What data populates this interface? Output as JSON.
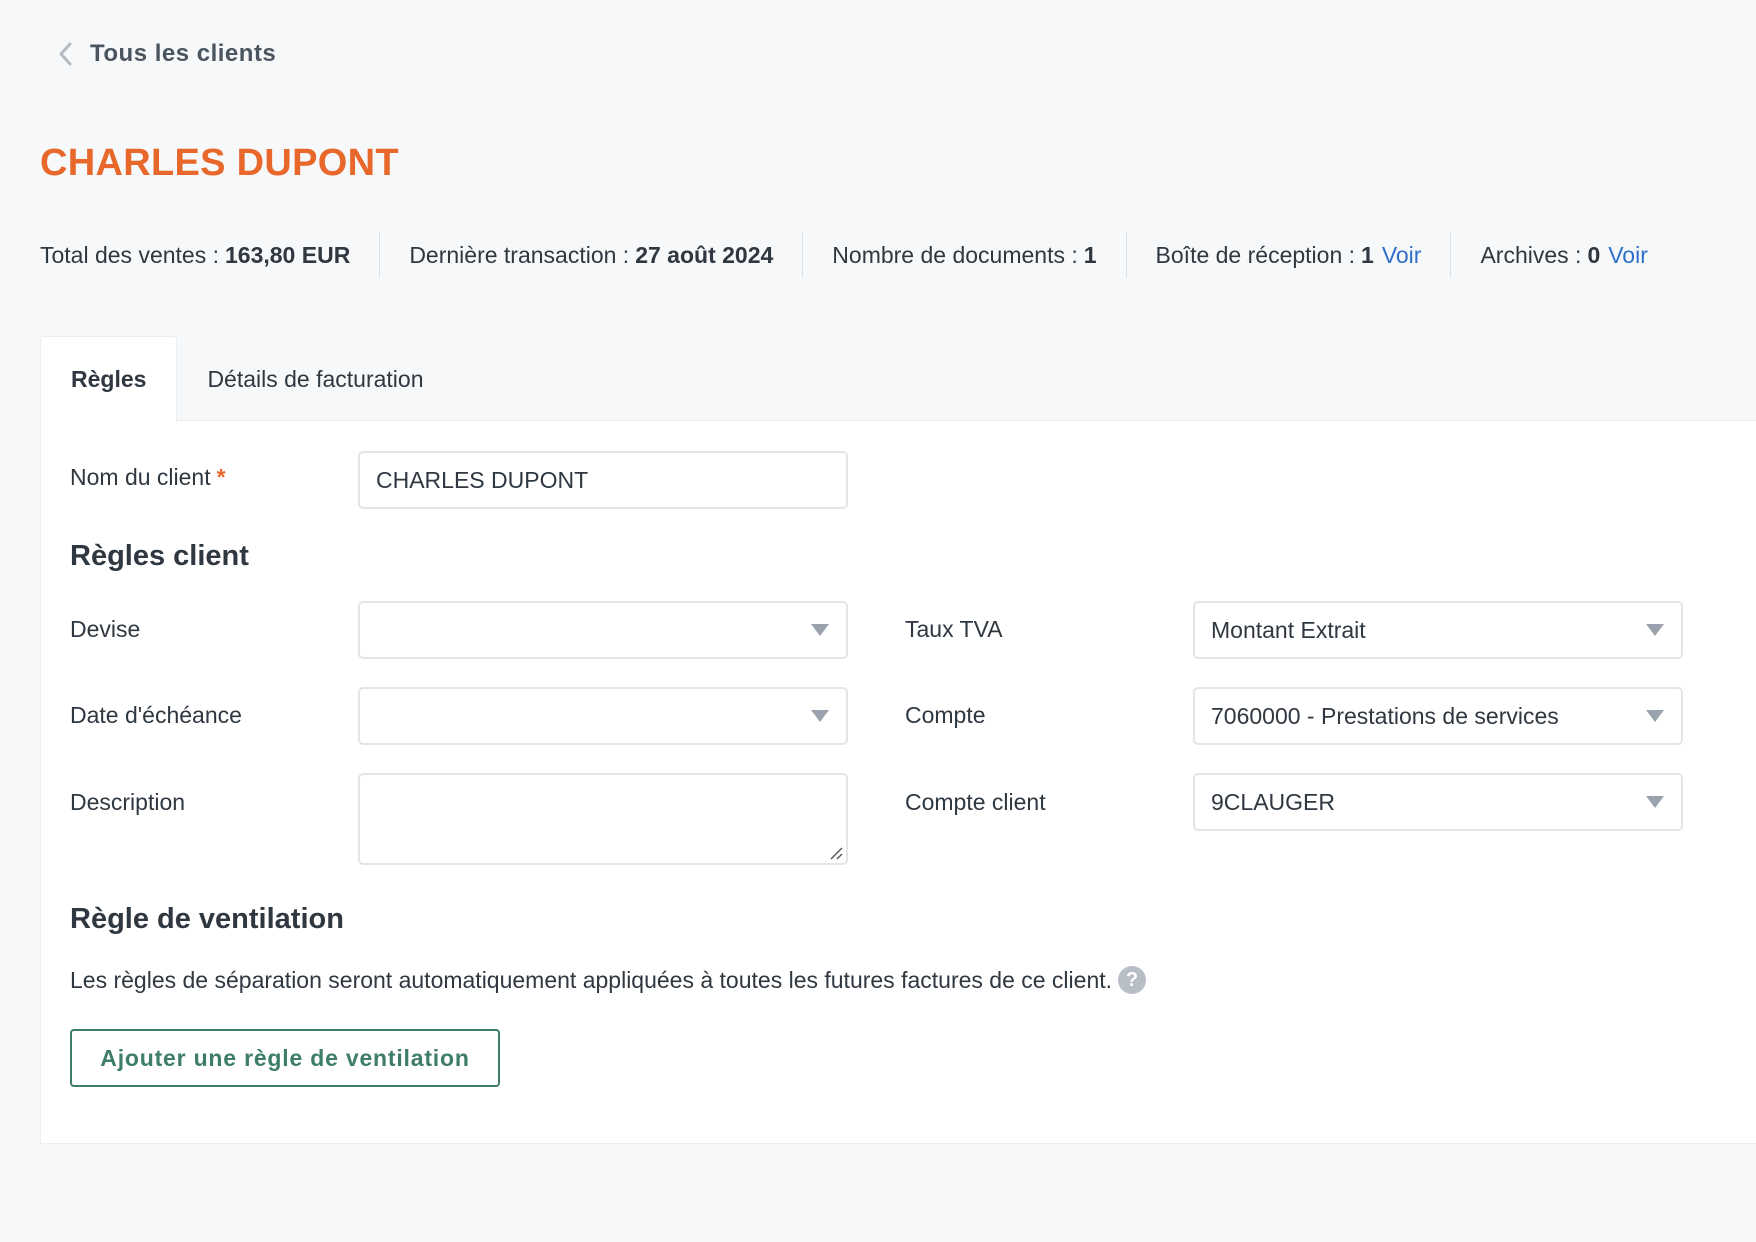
{
  "nav": {
    "back_label": "Tous les clients"
  },
  "client": {
    "title": "CHARLES DUPONT"
  },
  "stats": [
    {
      "label": "Total des ventes :",
      "value": "163,80 EUR"
    },
    {
      "label": "Dernière transaction :",
      "value": "27 août 2024"
    },
    {
      "label": "Nombre de documents :",
      "value": "1"
    },
    {
      "label": "Boîte de réception :",
      "value": "1",
      "link": "Voir"
    },
    {
      "label": "Archives :",
      "value": "0",
      "link": "Voir"
    }
  ],
  "tabs": [
    {
      "label": "Règles",
      "active": true
    },
    {
      "label": "Détails de facturation",
      "active": false
    }
  ],
  "form": {
    "client_name_label": "Nom du client",
    "required_mark": "*",
    "client_name_value": "CHARLES DUPONT",
    "rules_section_title": "Règles client",
    "devise_label": "Devise",
    "devise_value": "",
    "due_date_label": "Date d'échéance",
    "due_date_value": "",
    "description_label": "Description",
    "description_value": "",
    "vat_label": "Taux TVA",
    "vat_value": "Montant Extrait",
    "account_label": "Compte",
    "account_value": "7060000 - Prestations de services",
    "client_account_label": "Compte client",
    "client_account_value": "9CLAUGER"
  },
  "ventilation": {
    "section_title": "Règle de ventilation",
    "help_text": "Les règles de séparation seront automatiquement appliquées à toutes les futures factures de ce client.",
    "help_icon": "?",
    "add_button_label": "Ajouter une règle de ventilation"
  },
  "colors": {
    "accent": "#e8672a",
    "link": "#2f6fcc",
    "button": "#3d7d6a"
  }
}
